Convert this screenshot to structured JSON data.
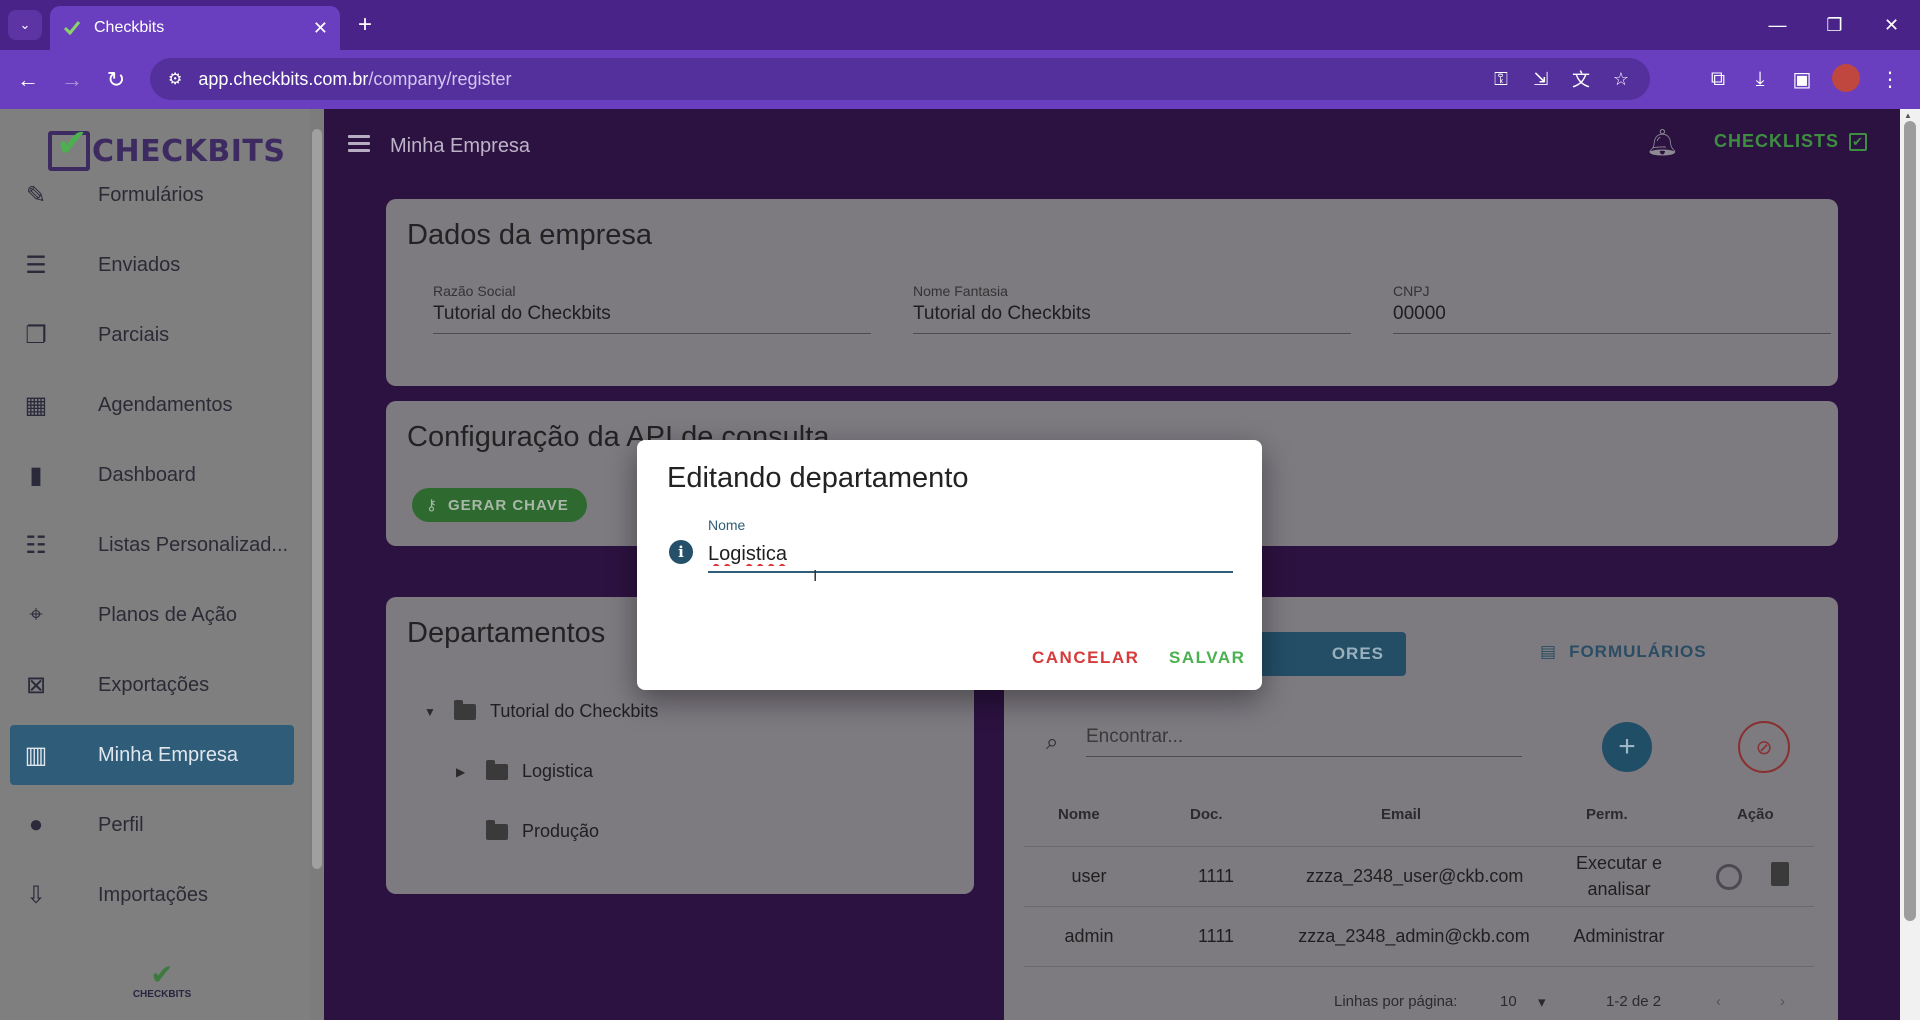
{
  "browser": {
    "tab_title": "Checkbits",
    "url_host": "app.checkbits.com.br",
    "url_path": "/company/register",
    "new_tab": "+",
    "close_tab": "✕"
  },
  "sidebar": {
    "logo_text": "CHECKBITS",
    "mini_logo_text": "CHECKBITS",
    "items": [
      {
        "label": "Formulários",
        "icon": "form-edit-icon",
        "glyph": "✎"
      },
      {
        "label": "Enviados",
        "icon": "sent-list-icon",
        "glyph": "☰"
      },
      {
        "label": "Parciais",
        "icon": "partial-docs-icon",
        "glyph": "❐"
      },
      {
        "label": "Agendamentos",
        "icon": "calendar-icon",
        "glyph": "▦"
      },
      {
        "label": "Dashboard",
        "icon": "bar-chart-icon",
        "glyph": "▮"
      },
      {
        "label": "Listas Personalizad...",
        "icon": "database-icon",
        "glyph": "☷"
      },
      {
        "label": "Planos de Ação",
        "icon": "crosshair-icon",
        "glyph": "⌖"
      },
      {
        "label": "Exportações",
        "icon": "excel-icon",
        "glyph": "⊠"
      },
      {
        "label": "Minha Empresa",
        "icon": "building-icon",
        "glyph": "▥"
      },
      {
        "label": "Perfil",
        "icon": "person-icon",
        "glyph": "●"
      },
      {
        "label": "Importações",
        "icon": "import-file-icon",
        "glyph": "⇩"
      }
    ],
    "active_index": 8
  },
  "header": {
    "page_title": "Minha Empresa",
    "checklists_label": "CHECKLISTS"
  },
  "company": {
    "title": "Dados da empresa",
    "razao_label": "Razão Social",
    "razao_value": "Tutorial do Checkbits",
    "fantasia_label": "Nome Fantasia",
    "fantasia_value": "Tutorial do Checkbits",
    "cnpj_label": "CNPJ",
    "cnpj_value": "00000"
  },
  "api": {
    "title": "Configuração da API de consulta",
    "generate_key_label": "GERAR CHAVE"
  },
  "departments": {
    "title": "Departamentos",
    "root": "Tutorial do Checkbits",
    "children": [
      "Logistica",
      "Produção"
    ]
  },
  "users_panel": {
    "tab_users_label": "ORES",
    "tab_forms_label": "FORMULÁRIOS",
    "search_placeholder": "Encontrar...",
    "columns": [
      "Nome",
      "Doc.",
      "Email",
      "Perm.",
      "Ação"
    ],
    "rows": [
      {
        "nome": "user",
        "doc": "1111",
        "email": "zzza_2348_user@ckb.com",
        "perm_line1": "Executar e",
        "perm_line2": "analisar"
      },
      {
        "nome": "admin",
        "doc": "1111",
        "email": "zzza_2348_admin@ckb.com",
        "perm_line1": "Administrar",
        "perm_line2": ""
      }
    ],
    "rows_per_page_label": "Linhas por página:",
    "rows_per_page_value": "10",
    "range_label": "1-2 de 2"
  },
  "modal": {
    "title": "Editando departamento",
    "field_label": "Nome",
    "field_value": "Logistica",
    "cancel_label": "CANCELAR",
    "save_label": "SALVAR"
  }
}
